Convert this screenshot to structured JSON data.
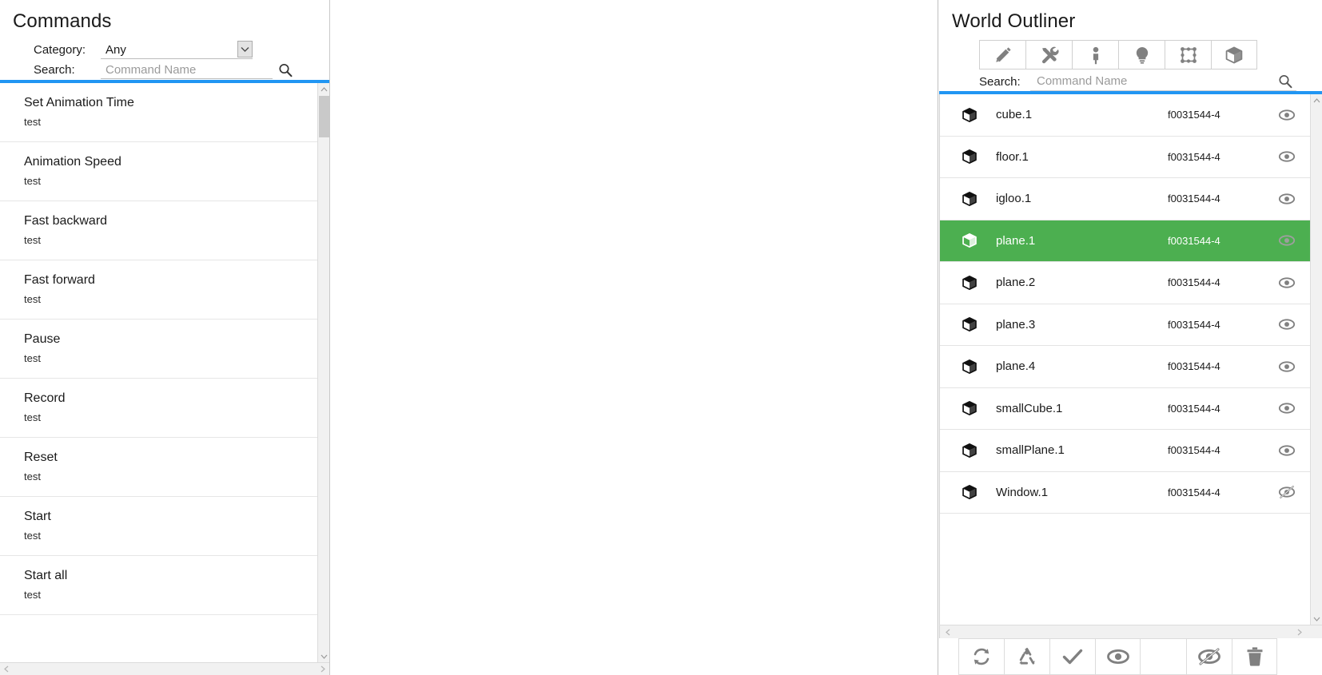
{
  "commands_panel": {
    "title": "Commands",
    "category_label": "Category:",
    "category_value": "Any",
    "category_options": [
      "Any"
    ],
    "search_label": "Search:",
    "search_value": "",
    "search_placeholder": "Command Name",
    "accent_color": "#2196f3",
    "items": [
      {
        "name": "Set Animation Time",
        "subtitle": "test"
      },
      {
        "name": "Animation Speed",
        "subtitle": "test"
      },
      {
        "name": "Fast backward",
        "subtitle": "test"
      },
      {
        "name": "Fast forward",
        "subtitle": "test"
      },
      {
        "name": "Pause",
        "subtitle": "test"
      },
      {
        "name": "Record",
        "subtitle": "test"
      },
      {
        "name": "Reset",
        "subtitle": "test"
      },
      {
        "name": "Start",
        "subtitle": "test"
      },
      {
        "name": "Start all",
        "subtitle": "test"
      }
    ]
  },
  "outliner_panel": {
    "title": "World Outliner",
    "search_label": "Search:",
    "search_value": "",
    "search_placeholder": "Command Name",
    "accent_color": "#2196f3",
    "selected_color": "#4caf50",
    "filter_buttons": [
      {
        "icon": "pencil-icon",
        "name": "filter-annotations"
      },
      {
        "icon": "tools-icon",
        "name": "filter-tools"
      },
      {
        "icon": "person-icon",
        "name": "filter-avatars"
      },
      {
        "icon": "lightbulb-icon",
        "name": "filter-lights"
      },
      {
        "icon": "bounds-icon",
        "name": "filter-bounds"
      },
      {
        "icon": "box-icon",
        "name": "filter-objects"
      }
    ],
    "rows": [
      {
        "icon": "box-icon",
        "name": "cube.1",
        "id": "f0031544-4",
        "visible": true,
        "selected": false
      },
      {
        "icon": "box-icon",
        "name": "floor.1",
        "id": "f0031544-4",
        "visible": true,
        "selected": false
      },
      {
        "icon": "box-icon",
        "name": "igloo.1",
        "id": "f0031544-4",
        "visible": true,
        "selected": false
      },
      {
        "icon": "box-icon",
        "name": "plane.1",
        "id": "f0031544-4",
        "visible": true,
        "selected": true
      },
      {
        "icon": "box-icon",
        "name": "plane.2",
        "id": "f0031544-4",
        "visible": true,
        "selected": false
      },
      {
        "icon": "box-icon",
        "name": "plane.3",
        "id": "f0031544-4",
        "visible": true,
        "selected": false
      },
      {
        "icon": "box-icon",
        "name": "plane.4",
        "id": "f0031544-4",
        "visible": true,
        "selected": false
      },
      {
        "icon": "box-icon",
        "name": "smallCube.1",
        "id": "f0031544-4",
        "visible": true,
        "selected": false
      },
      {
        "icon": "box-icon",
        "name": "smallPlane.1",
        "id": "f0031544-4",
        "visible": true,
        "selected": false
      },
      {
        "icon": "box-icon",
        "name": "Window.1",
        "id": "f0031544-4",
        "visible": false,
        "selected": false
      }
    ],
    "bottom_toolbar": [
      {
        "icon": "refresh-icon",
        "name": "refresh-button"
      },
      {
        "icon": "recycle-icon",
        "name": "recycle-button"
      },
      {
        "icon": "check-icon",
        "name": "select-button"
      },
      {
        "icon": "eye-icon",
        "name": "show-all-button"
      },
      {
        "icon": "spacer",
        "name": "toolbar-spacer"
      },
      {
        "icon": "eye-off-icon",
        "name": "hide-all-button"
      },
      {
        "icon": "trash-icon",
        "name": "delete-button"
      }
    ]
  }
}
